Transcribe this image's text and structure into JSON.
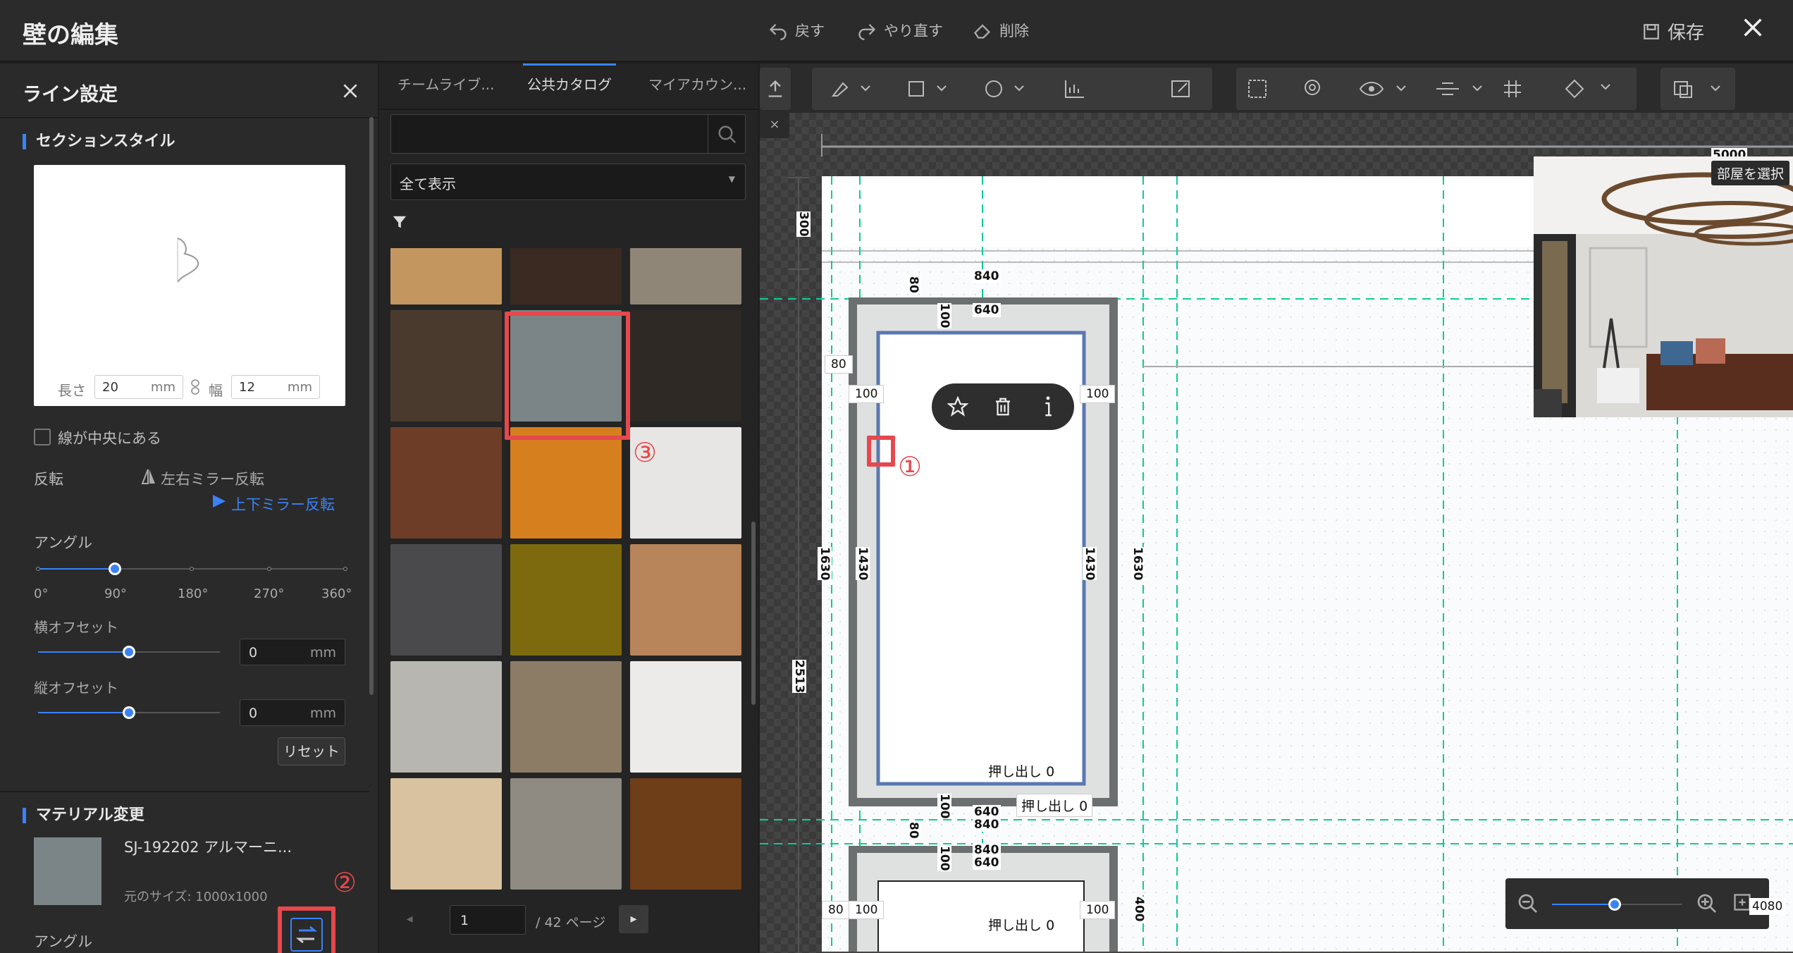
{
  "app": {
    "title": "壁の編集",
    "undo": "戻す",
    "redo": "やり直す",
    "delete": "削除",
    "save": "保存"
  },
  "line": {
    "title": "ライン設定",
    "section_style": "セクションスタイル",
    "length_label": "長さ",
    "length_value": "20",
    "width_label": "幅",
    "width_value": "12",
    "unit": "mm",
    "center_check": "線が中央にある",
    "flip_label": "反転",
    "flip_lr": "左右ミラー反転",
    "flip_ud": "上下ミラー反転",
    "angle_label": "アングル",
    "angle_ticks": [
      "0°",
      "90°",
      "180°",
      "270°",
      "360°"
    ],
    "angle_value": 90,
    "h_offset_label": "横オフセット",
    "h_offset_value": "0",
    "v_offset_label": "縦オフセット",
    "v_offset_value": "0",
    "reset": "リセット",
    "material_title": "マテリアル変更",
    "material_name": "SJ-192202 アルマーニ...",
    "material_size": "元のサイズ: 1000x1000",
    "angle2": "アングル"
  },
  "catalog": {
    "tabs": [
      "チームライブ...",
      "公共カタログ",
      "マイアカウン..."
    ],
    "active_tab": 1,
    "filter": "全て表示",
    "page": "1",
    "page_total": "/ 42 ページ",
    "swatches": [
      [
        "#c4965f",
        "#3a2a22",
        "#8f8677"
      ],
      [
        "#4a3a2e",
        "#7b8587",
        "#2e2925"
      ],
      [
        "#6e3d28",
        "#d67f1e",
        "#e8e6e4"
      ],
      [
        "#4a4a4c",
        "#7d6a0e",
        "#b8845a"
      ],
      [
        "#b8b6b0",
        "#8c7c66",
        "#ecebea"
      ],
      [
        "#d8c2a0",
        "#8f8a82",
        "#6e3e18"
      ]
    ]
  },
  "canvas": {
    "room_select": "部屋を選択",
    "dims": {
      "d5000": "5000",
      "d840": "840",
      "d640": "640",
      "d80": "80",
      "d100": "100",
      "d1430": "1430",
      "d1630": "1630",
      "d300": "300",
      "d2513": "2513",
      "d400": "400"
    },
    "extrude": "押し出し",
    "extrude_val": "0",
    "zoom_value": "4080"
  },
  "marks": {
    "one": "①",
    "two": "②",
    "three": "③"
  },
  "colors": {
    "accent": "#3b82f6",
    "annotation": "#e5484d",
    "guide": "#17c9a0"
  }
}
